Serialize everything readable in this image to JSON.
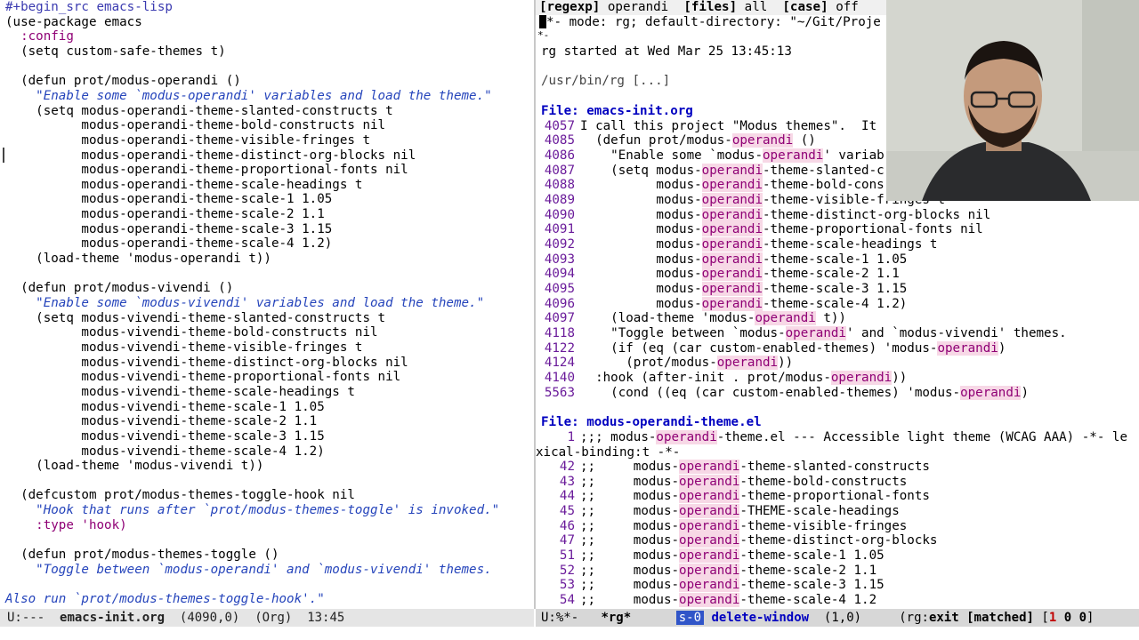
{
  "left_pane": {
    "lines": [
      "#+begin_src emacs-lisp",
      "(use-package emacs",
      "  :config",
      "  (setq custom-safe-themes t)",
      "",
      "  (defun prot/modus-operandi ()",
      "    \"Enable some `modus-operandi' variables and load the theme.\"",
      "    (setq modus-operandi-theme-slanted-constructs t",
      "          modus-operandi-theme-bold-constructs nil",
      "          modus-operandi-theme-visible-fringes t",
      "          modus-operandi-theme-distinct-org-blocks nil",
      "          modus-operandi-theme-proportional-fonts nil",
      "          modus-operandi-theme-scale-headings t",
      "          modus-operandi-theme-scale-1 1.05",
      "          modus-operandi-theme-scale-2 1.1",
      "          modus-operandi-theme-scale-3 1.15",
      "          modus-operandi-theme-scale-4 1.2)",
      "    (load-theme 'modus-operandi t))",
      "",
      "  (defun prot/modus-vivendi ()",
      "    \"Enable some `modus-vivendi' variables and load the theme.\"",
      "    (setq modus-vivendi-theme-slanted-constructs t",
      "          modus-vivendi-theme-bold-constructs nil",
      "          modus-vivendi-theme-visible-fringes t",
      "          modus-vivendi-theme-distinct-org-blocks nil",
      "          modus-vivendi-theme-proportional-fonts nil",
      "          modus-vivendi-theme-scale-headings t",
      "          modus-vivendi-theme-scale-1 1.05",
      "          modus-vivendi-theme-scale-2 1.1",
      "          modus-vivendi-theme-scale-3 1.15",
      "          modus-vivendi-theme-scale-4 1.2)",
      "    (load-theme 'modus-vivendi t))",
      "",
      "  (defcustom prot/modus-themes-toggle-hook nil",
      "    \"Hook that runs after `prot/modus-themes-toggle' is invoked.\"",
      "    :type 'hook)",
      "",
      "  (defun prot/modus-themes-toggle ()",
      "    \"Toggle between `modus-operandi' and `modus-vivendi' themes.",
      "",
      "Also run `prot/modus-themes-toggle-hook'.\""
    ],
    "modeline": {
      "state": "U:---",
      "buffer": "emacs-init.org",
      "position": "(4090,0)",
      "mode": "(Org)",
      "time": "13:45"
    }
  },
  "right_pane": {
    "header": {
      "regexp_label": "[regexp]",
      "regexp_value": "operandi",
      "files_label": "[files]",
      "files_value": "all",
      "case_label": "[case]",
      "case_value": "off"
    },
    "mode_line_text": "*- mode: rg; default-directory: \"~/Git/Proje",
    "mode_line_cont": "*-",
    "started": "rg started at Wed Mar 25 13:45:13",
    "command": "/usr/bin/rg [...]",
    "file1_label": "File:",
    "file1_name": "emacs-init.org",
    "file1_results": [
      {
        "n": "4057",
        "pre": "I call this project \"Modus themes\".  It",
        "m": "",
        "post": ""
      },
      {
        "n": "4085",
        "pre": "  (defun prot/modus-",
        "m": "operandi",
        "post": " ()"
      },
      {
        "n": "4086",
        "pre": "    \"Enable some `modus-",
        "m": "operandi",
        "post": "' variab"
      },
      {
        "n": "4087",
        "pre": "    (setq modus-",
        "m": "operandi",
        "post": "-theme-slanted-c"
      },
      {
        "n": "4088",
        "pre": "          modus-",
        "m": "operandi",
        "post": "-theme-bold-cons"
      },
      {
        "n": "4089",
        "pre": "          modus-",
        "m": "operandi",
        "post": "-theme-visible-fringes t"
      },
      {
        "n": "4090",
        "pre": "          modus-",
        "m": "operandi",
        "post": "-theme-distinct-org-blocks nil"
      },
      {
        "n": "4091",
        "pre": "          modus-",
        "m": "operandi",
        "post": "-theme-proportional-fonts nil"
      },
      {
        "n": "4092",
        "pre": "          modus-",
        "m": "operandi",
        "post": "-theme-scale-headings t"
      },
      {
        "n": "4093",
        "pre": "          modus-",
        "m": "operandi",
        "post": "-theme-scale-1 1.05"
      },
      {
        "n": "4094",
        "pre": "          modus-",
        "m": "operandi",
        "post": "-theme-scale-2 1.1"
      },
      {
        "n": "4095",
        "pre": "          modus-",
        "m": "operandi",
        "post": "-theme-scale-3 1.15"
      },
      {
        "n": "4096",
        "pre": "          modus-",
        "m": "operandi",
        "post": "-theme-scale-4 1.2)"
      },
      {
        "n": "4097",
        "pre": "    (load-theme 'modus-",
        "m": "operandi",
        "post": " t))"
      },
      {
        "n": "4118",
        "pre": "    \"Toggle between `modus-",
        "m": "operandi",
        "post": "' and `modus-vivendi' themes."
      },
      {
        "n": "4122",
        "pre": "    (if (eq (car custom-enabled-themes) 'modus-",
        "m": "operandi",
        "post": ")"
      },
      {
        "n": "4124",
        "pre": "      (prot/modus-",
        "m": "operandi",
        "post": "))"
      },
      {
        "n": "4140",
        "pre": "  :hook (after-init . prot/modus-",
        "m": "operandi",
        "post": "))"
      },
      {
        "n": "5563",
        "pre": "    (cond ((eq (car custom-enabled-themes) 'modus-",
        "m": "operandi",
        "post": ")"
      }
    ],
    "file2_label": "File:",
    "file2_name": "modus-operandi-theme.el",
    "file2_first": {
      "n": "1",
      "pre": ";;; modus-",
      "m": "operandi",
      "post": "-theme.el --- Accessible light theme (WCAG AAA) -*- le"
    },
    "file2_wrap": "xical-binding:t -*-",
    "file2_results": [
      {
        "n": "42",
        "pre": ";;     modus-",
        "m": "operandi",
        "post": "-theme-slanted-constructs"
      },
      {
        "n": "43",
        "pre": ";;     modus-",
        "m": "operandi",
        "post": "-theme-bold-constructs"
      },
      {
        "n": "44",
        "pre": ";;     modus-",
        "m": "operandi",
        "post": "-theme-proportional-fonts"
      },
      {
        "n": "45",
        "pre": ";;     modus-",
        "m": "operandi",
        "post": "-THEME-scale-headings"
      },
      {
        "n": "46",
        "pre": ";;     modus-",
        "m": "operandi",
        "post": "-theme-visible-fringes"
      },
      {
        "n": "47",
        "pre": ";;     modus-",
        "m": "operandi",
        "post": "-theme-distinct-org-blocks"
      },
      {
        "n": "51",
        "pre": ";;     modus-",
        "m": "operandi",
        "post": "-theme-scale-1 1.05"
      },
      {
        "n": "52",
        "pre": ";;     modus-",
        "m": "operandi",
        "post": "-theme-scale-2 1.1"
      },
      {
        "n": "53",
        "pre": ";;     modus-",
        "m": "operandi",
        "post": "-theme-scale-3 1.15"
      },
      {
        "n": "54",
        "pre": ";;     modus-",
        "m": "operandi",
        "post": "-theme-scale-4 1.2"
      }
    ],
    "modeline": {
      "state": "U:%*-",
      "buffer": "*rg*",
      "key_state": "s-0",
      "command": "delete-window",
      "position": "(1,0)",
      "status_open": "(rg:",
      "status_exit": "exit",
      "status_matched": "[matched]",
      "status_counts_open": "[",
      "count_1": "1",
      "count_2": "0",
      "count_3": "0",
      "status_counts_close": "]"
    }
  },
  "colors": {
    "match_bg": "#f7d8e6",
    "match_fg": "#8f0075",
    "file_header": "#0000c0",
    "line_number": "#6a1b9a",
    "modeline_active": "#d7d7d7",
    "modeline_inactive": "#e5e5e5",
    "keycast": "#3055c8"
  }
}
